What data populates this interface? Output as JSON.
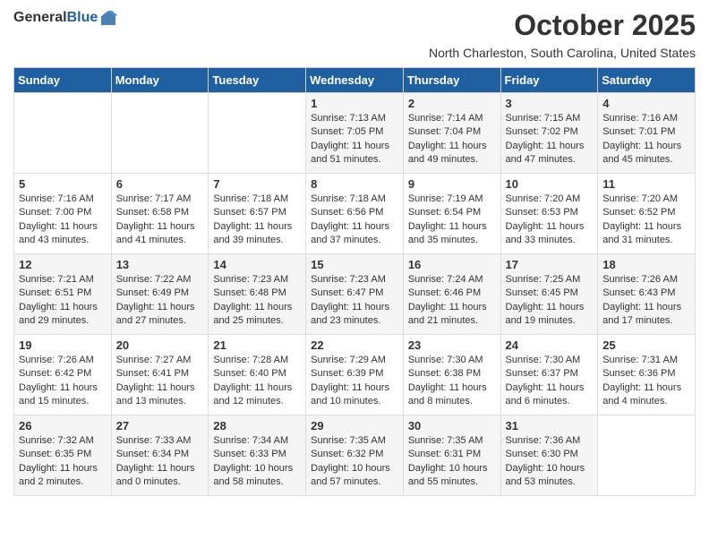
{
  "header": {
    "logo_general": "General",
    "logo_blue": "Blue",
    "month_title": "October 2025",
    "location": "North Charleston, South Carolina, United States"
  },
  "days_of_week": [
    "Sunday",
    "Monday",
    "Tuesday",
    "Wednesday",
    "Thursday",
    "Friday",
    "Saturday"
  ],
  "weeks": [
    [
      {
        "day": "",
        "text": ""
      },
      {
        "day": "",
        "text": ""
      },
      {
        "day": "",
        "text": ""
      },
      {
        "day": "1",
        "text": "Sunrise: 7:13 AM\nSunset: 7:05 PM\nDaylight: 11 hours\nand 51 minutes."
      },
      {
        "day": "2",
        "text": "Sunrise: 7:14 AM\nSunset: 7:04 PM\nDaylight: 11 hours\nand 49 minutes."
      },
      {
        "day": "3",
        "text": "Sunrise: 7:15 AM\nSunset: 7:02 PM\nDaylight: 11 hours\nand 47 minutes."
      },
      {
        "day": "4",
        "text": "Sunrise: 7:16 AM\nSunset: 7:01 PM\nDaylight: 11 hours\nand 45 minutes."
      }
    ],
    [
      {
        "day": "5",
        "text": "Sunrise: 7:16 AM\nSunset: 7:00 PM\nDaylight: 11 hours\nand 43 minutes."
      },
      {
        "day": "6",
        "text": "Sunrise: 7:17 AM\nSunset: 6:58 PM\nDaylight: 11 hours\nand 41 minutes."
      },
      {
        "day": "7",
        "text": "Sunrise: 7:18 AM\nSunset: 6:57 PM\nDaylight: 11 hours\nand 39 minutes."
      },
      {
        "day": "8",
        "text": "Sunrise: 7:18 AM\nSunset: 6:56 PM\nDaylight: 11 hours\nand 37 minutes."
      },
      {
        "day": "9",
        "text": "Sunrise: 7:19 AM\nSunset: 6:54 PM\nDaylight: 11 hours\nand 35 minutes."
      },
      {
        "day": "10",
        "text": "Sunrise: 7:20 AM\nSunset: 6:53 PM\nDaylight: 11 hours\nand 33 minutes."
      },
      {
        "day": "11",
        "text": "Sunrise: 7:20 AM\nSunset: 6:52 PM\nDaylight: 11 hours\nand 31 minutes."
      }
    ],
    [
      {
        "day": "12",
        "text": "Sunrise: 7:21 AM\nSunset: 6:51 PM\nDaylight: 11 hours\nand 29 minutes."
      },
      {
        "day": "13",
        "text": "Sunrise: 7:22 AM\nSunset: 6:49 PM\nDaylight: 11 hours\nand 27 minutes."
      },
      {
        "day": "14",
        "text": "Sunrise: 7:23 AM\nSunset: 6:48 PM\nDaylight: 11 hours\nand 25 minutes."
      },
      {
        "day": "15",
        "text": "Sunrise: 7:23 AM\nSunset: 6:47 PM\nDaylight: 11 hours\nand 23 minutes."
      },
      {
        "day": "16",
        "text": "Sunrise: 7:24 AM\nSunset: 6:46 PM\nDaylight: 11 hours\nand 21 minutes."
      },
      {
        "day": "17",
        "text": "Sunrise: 7:25 AM\nSunset: 6:45 PM\nDaylight: 11 hours\nand 19 minutes."
      },
      {
        "day": "18",
        "text": "Sunrise: 7:26 AM\nSunset: 6:43 PM\nDaylight: 11 hours\nand 17 minutes."
      }
    ],
    [
      {
        "day": "19",
        "text": "Sunrise: 7:26 AM\nSunset: 6:42 PM\nDaylight: 11 hours\nand 15 minutes."
      },
      {
        "day": "20",
        "text": "Sunrise: 7:27 AM\nSunset: 6:41 PM\nDaylight: 11 hours\nand 13 minutes."
      },
      {
        "day": "21",
        "text": "Sunrise: 7:28 AM\nSunset: 6:40 PM\nDaylight: 11 hours\nand 12 minutes."
      },
      {
        "day": "22",
        "text": "Sunrise: 7:29 AM\nSunset: 6:39 PM\nDaylight: 11 hours\nand 10 minutes."
      },
      {
        "day": "23",
        "text": "Sunrise: 7:30 AM\nSunset: 6:38 PM\nDaylight: 11 hours\nand 8 minutes."
      },
      {
        "day": "24",
        "text": "Sunrise: 7:30 AM\nSunset: 6:37 PM\nDaylight: 11 hours\nand 6 minutes."
      },
      {
        "day": "25",
        "text": "Sunrise: 7:31 AM\nSunset: 6:36 PM\nDaylight: 11 hours\nand 4 minutes."
      }
    ],
    [
      {
        "day": "26",
        "text": "Sunrise: 7:32 AM\nSunset: 6:35 PM\nDaylight: 11 hours\nand 2 minutes."
      },
      {
        "day": "27",
        "text": "Sunrise: 7:33 AM\nSunset: 6:34 PM\nDaylight: 11 hours\nand 0 minutes."
      },
      {
        "day": "28",
        "text": "Sunrise: 7:34 AM\nSunset: 6:33 PM\nDaylight: 10 hours\nand 58 minutes."
      },
      {
        "day": "29",
        "text": "Sunrise: 7:35 AM\nSunset: 6:32 PM\nDaylight: 10 hours\nand 57 minutes."
      },
      {
        "day": "30",
        "text": "Sunrise: 7:35 AM\nSunset: 6:31 PM\nDaylight: 10 hours\nand 55 minutes."
      },
      {
        "day": "31",
        "text": "Sunrise: 7:36 AM\nSunset: 6:30 PM\nDaylight: 10 hours\nand 53 minutes."
      },
      {
        "day": "",
        "text": ""
      }
    ]
  ]
}
